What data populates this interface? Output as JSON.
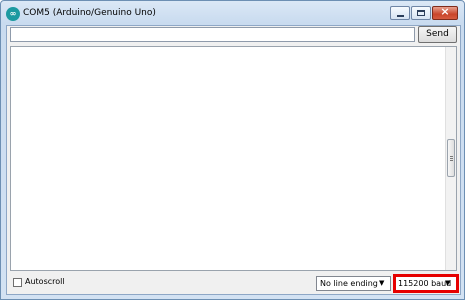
{
  "window": {
    "title": "COM5 (Arduino/Genuino Uno)",
    "icon": "arduino-icon",
    "controls": [
      "minimize-icon",
      "maximize-icon",
      "close-icon"
    ]
  },
  "input": {
    "value": "",
    "placeholder": ""
  },
  "send": {
    "label": "Send"
  },
  "output": {
    "text": ""
  },
  "bottom": {
    "autoscroll": {
      "label": "Autoscroll",
      "checked": false
    },
    "line_ending": {
      "selected": "No line ending"
    },
    "baud": {
      "selected": "115200 baud"
    }
  },
  "colors": {
    "highlight": "#e60000"
  }
}
